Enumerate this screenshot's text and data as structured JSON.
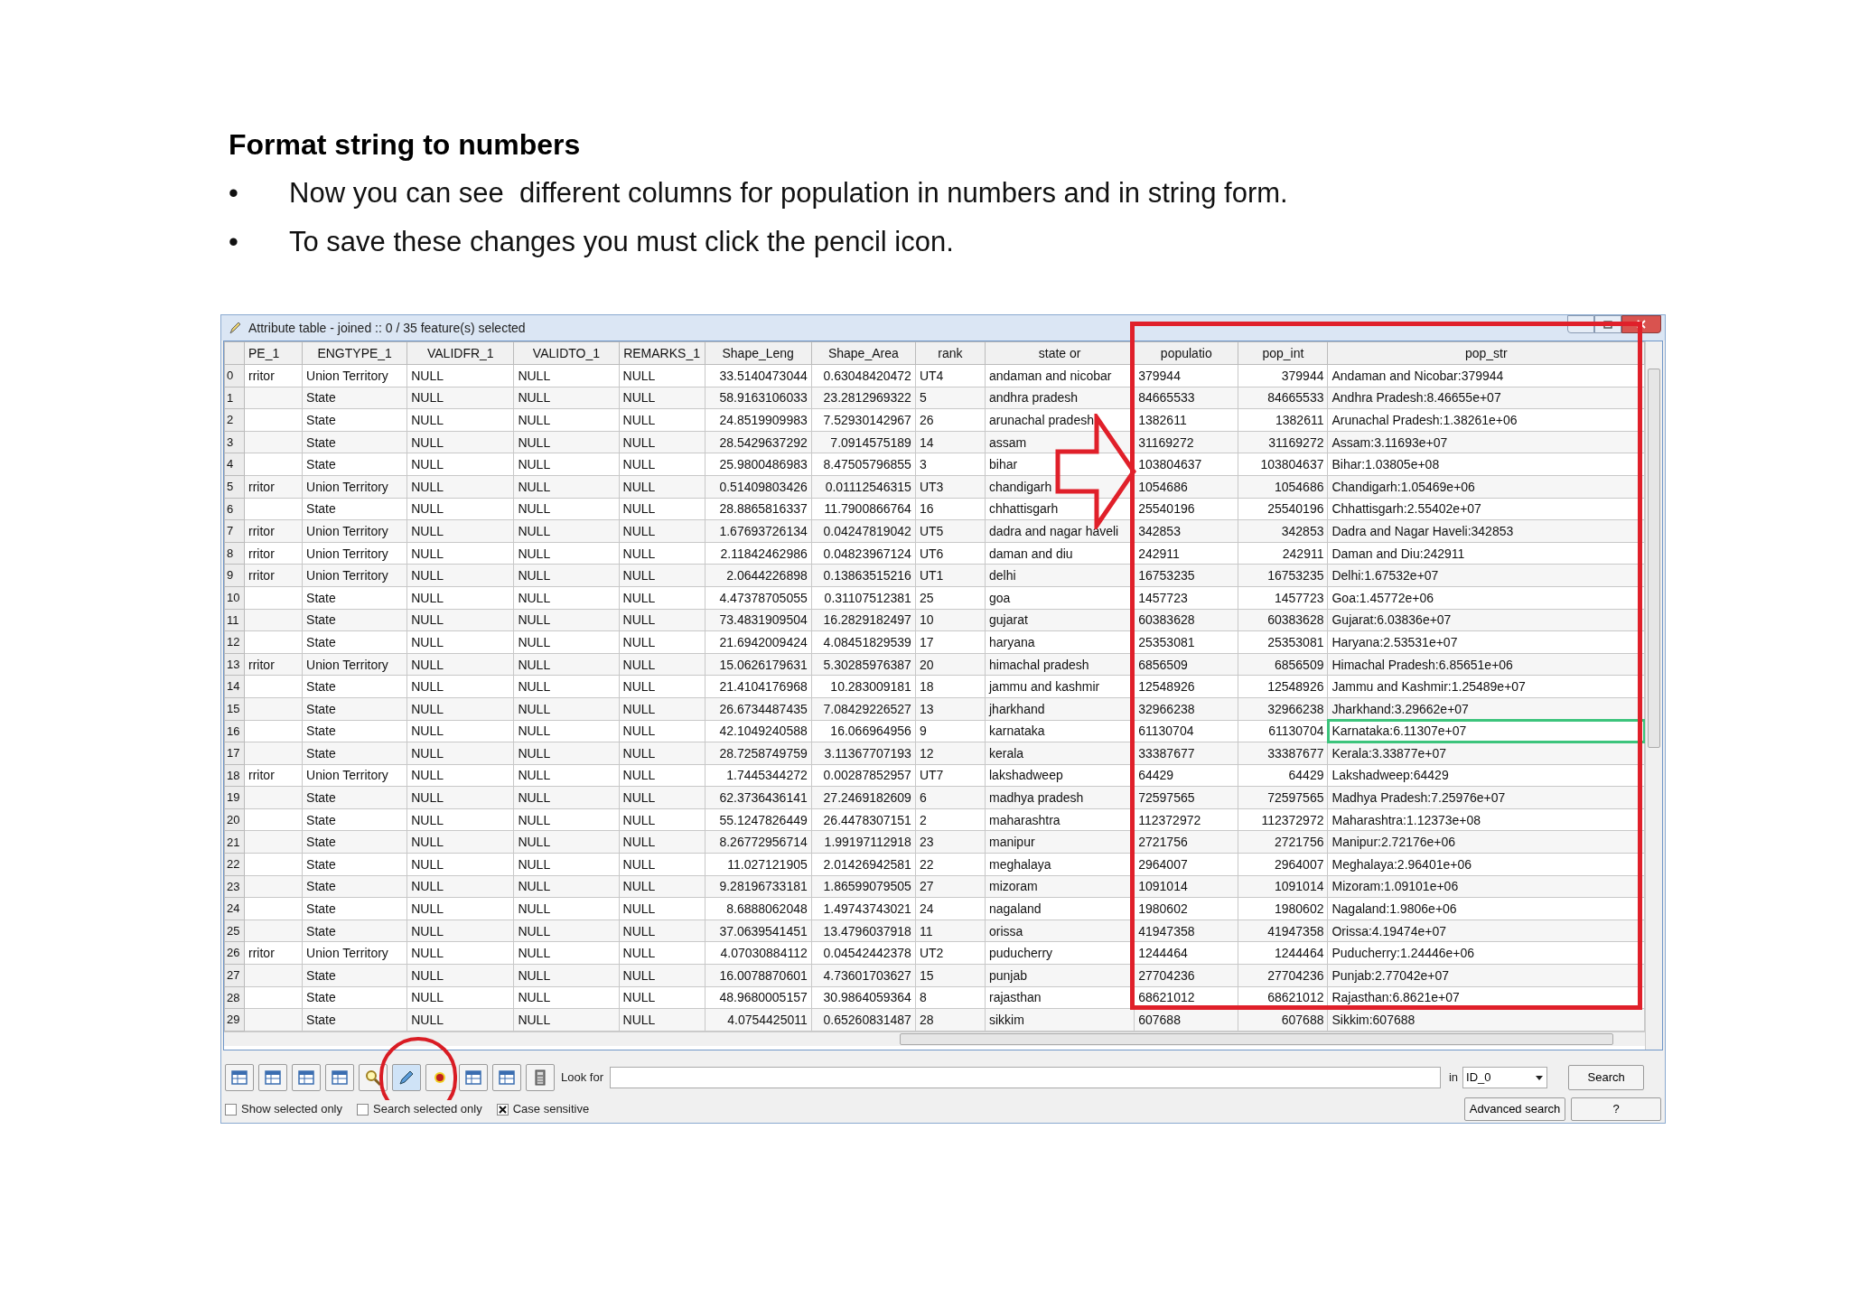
{
  "slide": {
    "heading": "Format string to numbers",
    "bullets": [
      {
        "bullet": "•",
        "text": "Now you can see  different columns for population in numbers and in string form."
      },
      {
        "bullet": "•",
        "text": "To save these changes you must click the pencil icon."
      }
    ]
  },
  "window": {
    "title": "Attribute table - joined :: 0 / 35 feature(s) selected"
  },
  "table": {
    "columns": [
      {
        "label": "PE_1",
        "kind": "text"
      },
      {
        "label": "ENGTYPE_1",
        "kind": "text"
      },
      {
        "label": "VALIDFR_1",
        "kind": "text"
      },
      {
        "label": "VALIDTO_1",
        "kind": "text"
      },
      {
        "label": "REMARKS_1",
        "kind": "text"
      },
      {
        "label": "Shape_Leng",
        "kind": "number"
      },
      {
        "label": "Shape_Area",
        "kind": "number"
      },
      {
        "label": "rank",
        "kind": "text"
      },
      {
        "label": "state or",
        "kind": "text"
      },
      {
        "label": "populatio",
        "kind": "text"
      },
      {
        "label": "pop_int",
        "kind": "number"
      },
      {
        "label": "pop_str",
        "kind": "text"
      }
    ],
    "rows": [
      {
        "header": "0",
        "focused": false,
        "cells": [
          "rritor",
          "Union Territory",
          "NULL",
          "NULL",
          "NULL",
          "33.5140473044",
          "0.63048420472",
          "UT4",
          "andaman and nicobar",
          "379944",
          "379944",
          "Andaman and Nicobar:379944"
        ]
      },
      {
        "header": "1",
        "focused": false,
        "cells": [
          null,
          "State",
          "NULL",
          "NULL",
          "NULL",
          "58.9163106033",
          "23.2812969322",
          "5",
          "andhra pradesh",
          "84665533",
          "84665533",
          "Andhra Pradesh:8.46655e+07"
        ]
      },
      {
        "header": "2",
        "focused": false,
        "cells": [
          null,
          "State",
          "NULL",
          "NULL",
          "NULL",
          "24.8519909983",
          "7.52930142967",
          "26",
          "arunachal pradesh",
          "1382611",
          "1382611",
          "Arunachal Pradesh:1.38261e+06"
        ]
      },
      {
        "header": "3",
        "focused": false,
        "cells": [
          null,
          "State",
          "NULL",
          "NULL",
          "NULL",
          "28.5429637292",
          "7.0914575189",
          "14",
          "assam",
          "31169272",
          "31169272",
          "Assam:3.11693e+07"
        ]
      },
      {
        "header": "4",
        "focused": false,
        "cells": [
          null,
          "State",
          "NULL",
          "NULL",
          "NULL",
          "25.9800486983",
          "8.47505796855",
          "3",
          "bihar",
          "103804637",
          "103804637",
          "Bihar:1.03805e+08"
        ]
      },
      {
        "header": "5",
        "focused": false,
        "cells": [
          "rritor",
          "Union Territory",
          "NULL",
          "NULL",
          "NULL",
          "0.51409803426",
          "0.01112546315",
          "UT3",
          "chandigarh",
          "1054686",
          "1054686",
          "Chandigarh:1.05469e+06"
        ]
      },
      {
        "header": "6",
        "focused": false,
        "cells": [
          null,
          "State",
          "NULL",
          "NULL",
          "NULL",
          "28.8865816337",
          "11.7900866764",
          "16",
          "chhattisgarh",
          "25540196",
          "25540196",
          "Chhattisgarh:2.55402e+07"
        ]
      },
      {
        "header": "7",
        "focused": false,
        "cells": [
          "rritor",
          "Union Territory",
          "NULL",
          "NULL",
          "NULL",
          "1.67693726134",
          "0.04247819042",
          "UT5",
          "dadra and nagar haveli",
          "342853",
          "342853",
          "Dadra and Nagar Haveli:342853"
        ]
      },
      {
        "header": "8",
        "focused": false,
        "cells": [
          "rritor",
          "Union Territory",
          "NULL",
          "NULL",
          "NULL",
          "2.11842462986",
          "0.04823967124",
          "UT6",
          "daman and diu",
          "242911",
          "242911",
          "Daman and Diu:242911"
        ]
      },
      {
        "header": "9",
        "focused": false,
        "cells": [
          "rritor",
          "Union Territory",
          "NULL",
          "NULL",
          "NULL",
          "2.0644226898",
          "0.13863515216",
          "UT1",
          "delhi",
          "16753235",
          "16753235",
          "Delhi:1.67532e+07"
        ]
      },
      {
        "header": "10",
        "focused": false,
        "cells": [
          null,
          "State",
          "NULL",
          "NULL",
          "NULL",
          "4.47378705055",
          "0.31107512381",
          "25",
          "goa",
          "1457723",
          "1457723",
          "Goa:1.45772e+06"
        ]
      },
      {
        "header": "11",
        "focused": false,
        "cells": [
          null,
          "State",
          "NULL",
          "NULL",
          "NULL",
          "73.4831909504",
          "16.2829182497",
          "10",
          "gujarat",
          "60383628",
          "60383628",
          "Gujarat:6.03836e+07"
        ]
      },
      {
        "header": "12",
        "focused": false,
        "cells": [
          null,
          "State",
          "NULL",
          "NULL",
          "NULL",
          "21.6942009424",
          "4.08451829539",
          "17",
          "haryana",
          "25353081",
          "25353081",
          "Haryana:2.53531e+07"
        ]
      },
      {
        "header": "13",
        "focused": false,
        "cells": [
          "rritor",
          "Union Territory",
          "NULL",
          "NULL",
          "NULL",
          "15.0626179631",
          "5.30285976387",
          "20",
          "himachal pradesh",
          "6856509",
          "6856509",
          "Himachal Pradesh:6.85651e+06"
        ]
      },
      {
        "header": "14",
        "focused": false,
        "cells": [
          null,
          "State",
          "NULL",
          "NULL",
          "NULL",
          "21.4104176968",
          "10.283009181",
          "18",
          "jammu and kashmir",
          "12548926",
          "12548926",
          "Jammu and Kashmir:1.25489e+07"
        ]
      },
      {
        "header": "15",
        "focused": false,
        "cells": [
          null,
          "State",
          "NULL",
          "NULL",
          "NULL",
          "26.6734487435",
          "7.08429226527",
          "13",
          "jharkhand",
          "32966238",
          "32966238",
          "Jharkhand:3.29662e+07"
        ]
      },
      {
        "header": "16",
        "focused": true,
        "cells": [
          null,
          "State",
          "NULL",
          "NULL",
          "NULL",
          "42.1049240588",
          "16.066964956",
          "9",
          "karnataka",
          "61130704",
          "61130704",
          "Karnataka:6.11307e+07"
        ]
      },
      {
        "header": "17",
        "focused": false,
        "cells": [
          null,
          "State",
          "NULL",
          "NULL",
          "NULL",
          "28.7258749759",
          "3.11367707193",
          "12",
          "kerala",
          "33387677",
          "33387677",
          "Kerala:3.33877e+07"
        ]
      },
      {
        "header": "18",
        "focused": false,
        "cells": [
          "rritor",
          "Union Territory",
          "NULL",
          "NULL",
          "NULL",
          "1.7445344272",
          "0.00287852957",
          "UT7",
          "lakshadweep",
          "64429",
          "64429",
          "Lakshadweep:64429"
        ]
      },
      {
        "header": "19",
        "focused": false,
        "cells": [
          null,
          "State",
          "NULL",
          "NULL",
          "NULL",
          "62.3736436141",
          "27.2469182609",
          "6",
          "madhya pradesh",
          "72597565",
          "72597565",
          "Madhya Pradesh:7.25976e+07"
        ]
      },
      {
        "header": "20",
        "focused": false,
        "cells": [
          null,
          "State",
          "NULL",
          "NULL",
          "NULL",
          "55.1247826449",
          "26.4478307151",
          "2",
          "maharashtra",
          "112372972",
          "112372972",
          "Maharashtra:1.12373e+08"
        ]
      },
      {
        "header": "21",
        "focused": false,
        "cells": [
          null,
          "State",
          "NULL",
          "NULL",
          "NULL",
          "8.26772956714",
          "1.99197112918",
          "23",
          "manipur",
          "2721756",
          "2721756",
          "Manipur:2.72176e+06"
        ]
      },
      {
        "header": "22",
        "focused": false,
        "cells": [
          null,
          "State",
          "NULL",
          "NULL",
          "NULL",
          "11.027121905",
          "2.01426942581",
          "22",
          "meghalaya",
          "2964007",
          "2964007",
          "Meghalaya:2.96401e+06"
        ]
      },
      {
        "header": "23",
        "focused": false,
        "cells": [
          null,
          "State",
          "NULL",
          "NULL",
          "NULL",
          "9.28196733181",
          "1.86599079505",
          "27",
          "mizoram",
          "1091014",
          "1091014",
          "Mizoram:1.09101e+06"
        ]
      },
      {
        "header": "24",
        "focused": false,
        "cells": [
          null,
          "State",
          "NULL",
          "NULL",
          "NULL",
          "8.6888062048",
          "1.49743743021",
          "24",
          "nagaland",
          "1980602",
          "1980602",
          "Nagaland:1.9806e+06"
        ]
      },
      {
        "header": "25",
        "focused": false,
        "cells": [
          null,
          "State",
          "NULL",
          "NULL",
          "NULL",
          "37.0639541451",
          "13.4796037918",
          "11",
          "orissa",
          "41947358",
          "41947358",
          "Orissa:4.19474e+07"
        ]
      },
      {
        "header": "26",
        "focused": false,
        "cells": [
          "rritor",
          "Union Territory",
          "NULL",
          "NULL",
          "NULL",
          "4.07030884112",
          "0.04542442378",
          "UT2",
          "puducherry",
          "1244464",
          "1244464",
          "Puducherry:1.24446e+06"
        ]
      },
      {
        "header": "27",
        "focused": false,
        "cells": [
          null,
          "State",
          "NULL",
          "NULL",
          "NULL",
          "16.0078870601",
          "4.73601703627",
          "15",
          "punjab",
          "27704236",
          "27704236",
          "Punjab:2.77042e+07"
        ]
      },
      {
        "header": "28",
        "focused": false,
        "cells": [
          null,
          "State",
          "NULL",
          "NULL",
          "NULL",
          "48.9680005157",
          "30.9864059364",
          "8",
          "rajasthan",
          "68621012",
          "68621012",
          "Rajasthan:6.8621e+07"
        ]
      },
      {
        "header": "29",
        "focused": false,
        "cells": [
          null,
          "State",
          "NULL",
          "NULL",
          "NULL",
          "4.0754425011",
          "0.65260831487",
          "28",
          "sikkim",
          "607688",
          "607688",
          "Sikkim:607688"
        ]
      }
    ]
  },
  "toolbar": {
    "edit_mode": true,
    "look_for_label": "Look for",
    "in_label": "in",
    "field_combo": "ID_0",
    "search_button": "Search"
  },
  "options": {
    "checkboxes": [
      {
        "label": "Show selected only",
        "checked": false
      },
      {
        "label": "Search selected only",
        "checked": false
      },
      {
        "label": "Case sensitive",
        "checked": true
      }
    ],
    "advanced_button": "Advanced search",
    "help_button": "?"
  }
}
